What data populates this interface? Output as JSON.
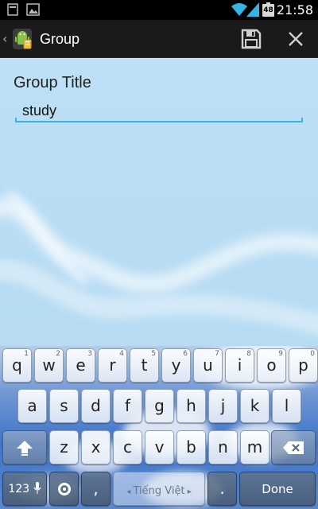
{
  "status_bar": {
    "time": "21:58",
    "battery_level": "48",
    "icons": [
      "notification-icon",
      "gallery-icon",
      "wifi-icon",
      "signal-icon",
      "battery-icon"
    ]
  },
  "action_bar": {
    "title": "Group",
    "icons": [
      "app-icon",
      "save-icon",
      "close-icon"
    ]
  },
  "form": {
    "label": "Group Title",
    "value": "study",
    "accent": "#33b5e5"
  },
  "keyboard": {
    "row1": [
      {
        "key": "q",
        "hint": "1"
      },
      {
        "key": "w",
        "hint": "2"
      },
      {
        "key": "e",
        "hint": "3"
      },
      {
        "key": "r",
        "hint": "4"
      },
      {
        "key": "t",
        "hint": "5"
      },
      {
        "key": "y",
        "hint": "6"
      },
      {
        "key": "u",
        "hint": "7"
      },
      {
        "key": "i",
        "hint": "8"
      },
      {
        "key": "o",
        "hint": "9"
      },
      {
        "key": "p",
        "hint": "0"
      }
    ],
    "row2": [
      "a",
      "s",
      "d",
      "f",
      "g",
      "h",
      "j",
      "k",
      "l"
    ],
    "row3": [
      "z",
      "x",
      "c",
      "v",
      "b",
      "n",
      "m"
    ],
    "shift_icon": "shift-icon",
    "delete_icon": "backspace-icon",
    "mode_key": "123",
    "mic_icon": "mic-icon",
    "settings_icon": "settings-icon",
    "comma": ",",
    "space_label": "Tiếng Việt",
    "period": ".",
    "done": "Done"
  }
}
